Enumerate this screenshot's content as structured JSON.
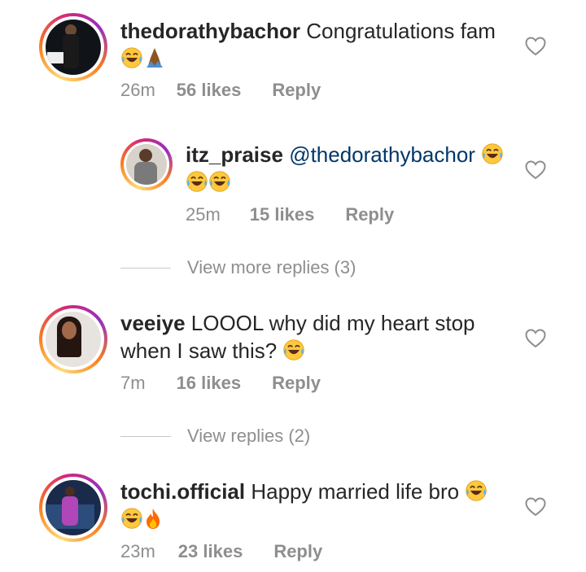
{
  "comments": [
    {
      "username": "thedorathybachor",
      "text": "Congratulations fam",
      "time": "26m",
      "likes": "56 likes",
      "reply": "Reply"
    },
    {
      "username": "itz_praise",
      "mention": "@thedorathybachor",
      "time": "25m",
      "likes": "15 likes",
      "reply": "Reply"
    },
    {
      "username": "veeiye",
      "text_line1": "LOOOL why did my heart stop",
      "text_line2": "when I saw this?",
      "time": "7m",
      "likes": "16 likes",
      "reply": "Reply"
    },
    {
      "username": "tochi.official",
      "text": "Happy married life bro",
      "time": "23m",
      "likes": "23 likes",
      "reply": "Reply"
    }
  ],
  "view_more_replies": "View more replies (3)",
  "view_replies": "View replies (2)",
  "icons": [
    "heart-outline-icon",
    "laughing-emoji-icon",
    "folded-hands-emoji-icon",
    "fire-emoji-icon"
  ],
  "colors": {
    "text": "#262626",
    "meta": "#8e8e8e",
    "mention": "#00376b"
  }
}
